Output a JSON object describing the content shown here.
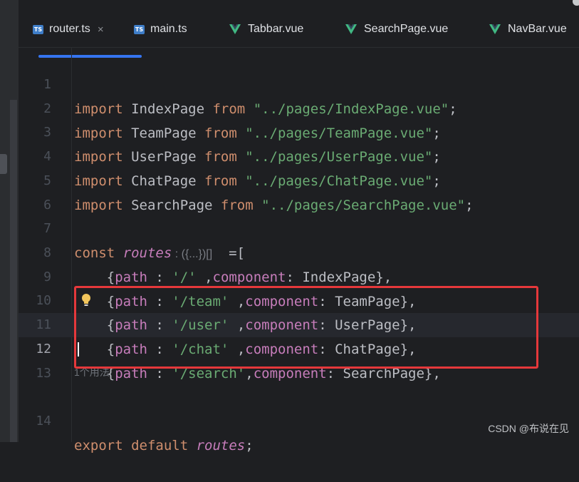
{
  "tabs": [
    {
      "label": "router.ts",
      "icon": "ts-icon",
      "icon_text": "TS",
      "close": "×",
      "active": true
    },
    {
      "label": "main.ts",
      "icon": "ts-icon",
      "icon_text": "TS"
    },
    {
      "label": "Tabbar.vue",
      "icon": "vue-icon"
    },
    {
      "label": "SearchPage.vue",
      "icon": "vue-icon"
    },
    {
      "label": "NavBar.vue",
      "icon": "vue-icon"
    }
  ],
  "colors": {
    "keyword": "#cf8e6d",
    "string": "#6aab73",
    "field": "#c77dbb",
    "accent": "#3574f0",
    "highlight_box": "#e5383b"
  },
  "lines": [
    {
      "n": "1",
      "kw": "import",
      "name": " IndexPage ",
      "from": "from",
      "str": " \"../pages/IndexPage.vue\"",
      "end": ";"
    },
    {
      "n": "2",
      "kw": "import",
      "name": " TeamPage ",
      "from": "from",
      "str": " \"../pages/TeamPage.vue\"",
      "end": ";"
    },
    {
      "n": "3",
      "kw": "import",
      "name": " UserPage ",
      "from": "from",
      "str": " \"../pages/UserPage.vue\"",
      "end": ";"
    },
    {
      "n": "4",
      "kw": "import",
      "name": " ChatPage ",
      "from": "from",
      "str": " \"../pages/ChatPage.vue\"",
      "end": ";"
    },
    {
      "n": "5",
      "kw": "import",
      "name": " SearchPage ",
      "from": "from",
      "str": " \"../pages/SearchPage.vue\"",
      "end": ";"
    },
    {
      "n": "6"
    },
    {
      "n": "7",
      "kw": "const",
      "var": " routes",
      "hint": " : ({...})[]",
      "end": "  =["
    },
    {
      "n": "8",
      "a": "    {",
      "p": "path",
      "b": " : ",
      "s": "'/'",
      "c": " ,",
      "comp": "component",
      "d": ": IndexPage},"
    },
    {
      "n": "9",
      "a": "    {",
      "p": "path",
      "b": " : ",
      "s": "'/team'",
      "c": " ,",
      "comp": "component",
      "d": ": TeamPage},"
    },
    {
      "n": "10",
      "a": "    {",
      "p": "path",
      "b": " : ",
      "s": "'/user'",
      "c": " ,",
      "comp": "component",
      "d": ": UserPage},"
    },
    {
      "n": "11",
      "a": "    {",
      "p": "path",
      "b": " : ",
      "s": "'/chat'",
      "c": " ,",
      "comp": "component",
      "d": ": ChatPage},"
    },
    {
      "n": "12",
      "a": "    {",
      "p": "path",
      "b": " : ",
      "s": "'/search'",
      "c": ",",
      "comp": "component",
      "d": ": SearchPage},"
    },
    {
      "n": "13"
    },
    {
      "n": "14",
      "kw": "export",
      "mid": " ",
      "kw2": "default",
      "var": " routes",
      "end": ";"
    }
  ],
  "usage_hint": "1个用法",
  "watermark": "CSDN @布说在见"
}
